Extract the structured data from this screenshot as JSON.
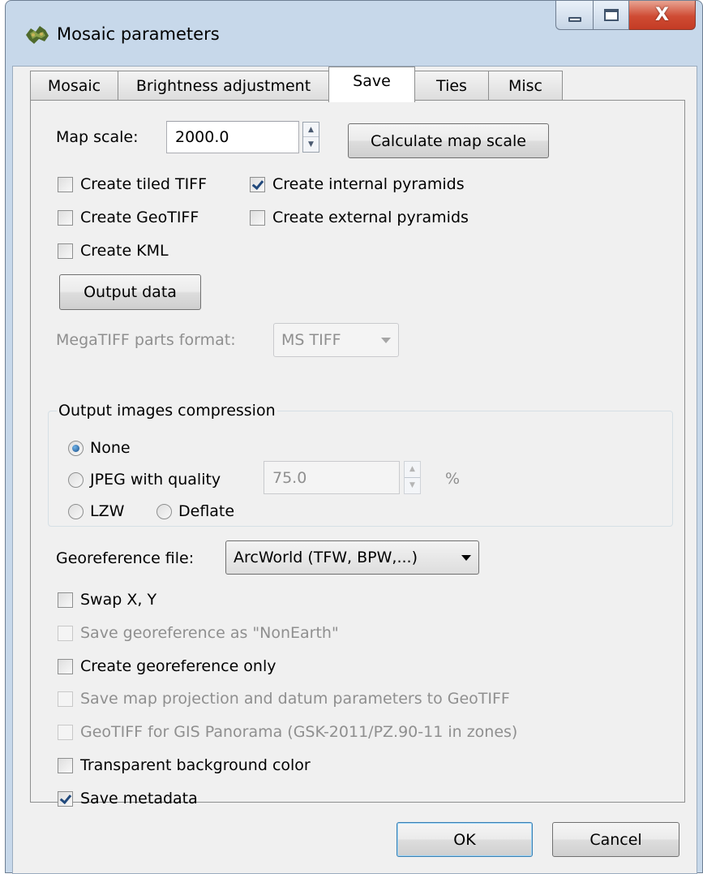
{
  "window": {
    "title": "Mosaic parameters",
    "close_glyph": "X"
  },
  "tabs": [
    {
      "label": "Mosaic",
      "active": false
    },
    {
      "label": "Brightness adjustment",
      "active": false
    },
    {
      "label": "Save",
      "active": true
    },
    {
      "label": "Ties",
      "active": false
    },
    {
      "label": "Misc",
      "active": false
    }
  ],
  "save": {
    "map_scale_label": "Map scale:",
    "map_scale_value": "2000.0",
    "calculate_button": "Calculate map scale",
    "create_tiled_tiff": {
      "label": "Create tiled TIFF",
      "checked": false
    },
    "create_internal_pyramids": {
      "label": "Create internal pyramids",
      "checked": true
    },
    "create_geotiff": {
      "label": "Create GeoTIFF",
      "checked": false
    },
    "create_external_pyramids": {
      "label": "Create external pyramids",
      "checked": false
    },
    "create_kml": {
      "label": "Create KML",
      "checked": false
    },
    "output_data_button": "Output data",
    "megatiff_label": "MegaTIFF parts format:",
    "megatiff_value": "MS TIFF",
    "compression": {
      "title": "Output images compression",
      "none_label": "None",
      "jpeg_label": "JPEG with quality",
      "jpeg_quality": "75.0",
      "percent": "%",
      "lzw_label": "LZW",
      "deflate_label": "Deflate",
      "selected": "None"
    },
    "georef_label": "Georeference file:",
    "georef_value": "ArcWorld (TFW, BPW,...)",
    "swap_xy": {
      "label": "Swap X, Y",
      "checked": false
    },
    "save_nonearth": {
      "label": "Save georeference as \"NonEarth\"",
      "checked": false,
      "enabled": false
    },
    "georef_only": {
      "label": "Create georeference only",
      "checked": false
    },
    "save_projection": {
      "label": "Save map projection and datum parameters to GeoTIFF",
      "checked": false,
      "enabled": false
    },
    "gis_panorama": {
      "label": "GeoTIFF for GIS Panorama (GSK-2011/PZ.90-11 in zones)",
      "checked": false,
      "enabled": false
    },
    "transparent_bg": {
      "label": "Transparent background color",
      "checked": false
    },
    "save_metadata": {
      "label": "Save metadata",
      "checked": true
    }
  },
  "footer": {
    "ok": "OK",
    "cancel": "Cancel"
  }
}
